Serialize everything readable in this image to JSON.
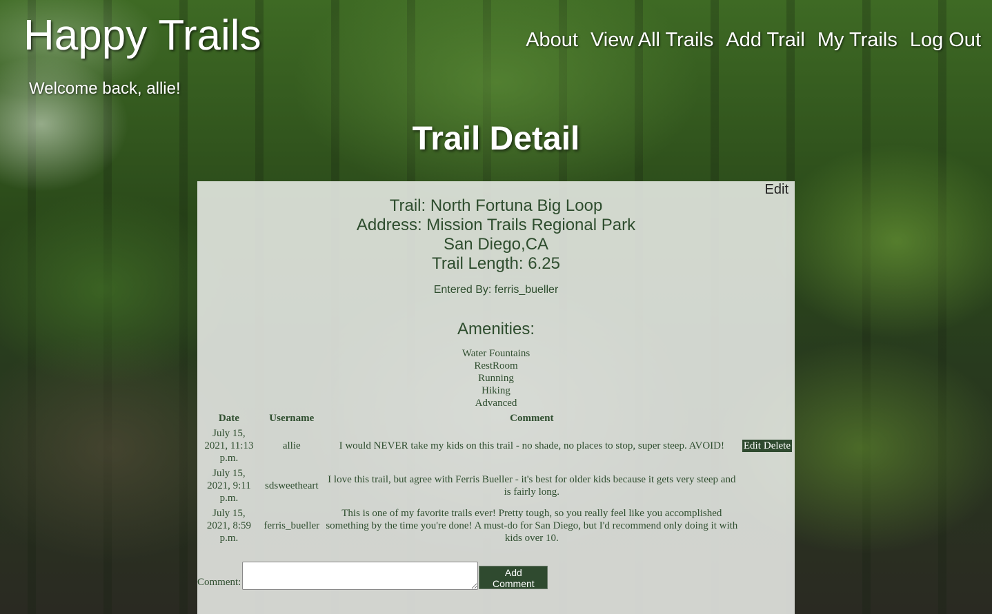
{
  "site": {
    "title": "Happy Trails"
  },
  "nav": [
    {
      "label": "About"
    },
    {
      "label": "View All Trails"
    },
    {
      "label": "Add Trail"
    },
    {
      "label": "My Trails"
    },
    {
      "label": "Log Out"
    }
  ],
  "welcome": "Welcome back, allie!",
  "page_title": "Trail Detail",
  "trail": {
    "edit_label": "Edit",
    "name_line": "Trail: North Fortuna Big Loop",
    "address_line": "Address: Mission Trails Regional Park",
    "city_line": "San Diego,CA",
    "length_line": "Trail Length: 6.25",
    "entered_by": "Entered By: ferris_bueller"
  },
  "amenities": {
    "title": "Amenities:",
    "items": [
      "Water Fountains",
      "RestRoom",
      "Running",
      "Hiking",
      "Advanced"
    ]
  },
  "comments": {
    "headers": {
      "date": "Date",
      "username": "Username",
      "comment": "Comment"
    },
    "rows": [
      {
        "date": "July 15, 2021, 11:13 p.m.",
        "username": "allie",
        "comment": "I would NEVER take my kids on this trail - no shade, no places to stop, super steep. AVOID!",
        "edit_label": "Edit",
        "delete_label": "Delete"
      },
      {
        "date": "July 15, 2021, 9:11 p.m.",
        "username": "sdsweetheart",
        "comment": "I love this trail, but agree with Ferris Bueller - it's best for older kids because it gets very steep and is fairly long."
      },
      {
        "date": "July 15, 2021, 8:59 p.m.",
        "username": "ferris_bueller",
        "comment": "This is one of my favorite trails ever! Pretty tough, so you really feel like you accomplished something by the time you're done! A must-do for San Diego, but I'd recommend only doing it with kids over 10."
      }
    ]
  },
  "form": {
    "label": "Comment:",
    "textarea_value": "",
    "submit_label": "Add Comment"
  }
}
